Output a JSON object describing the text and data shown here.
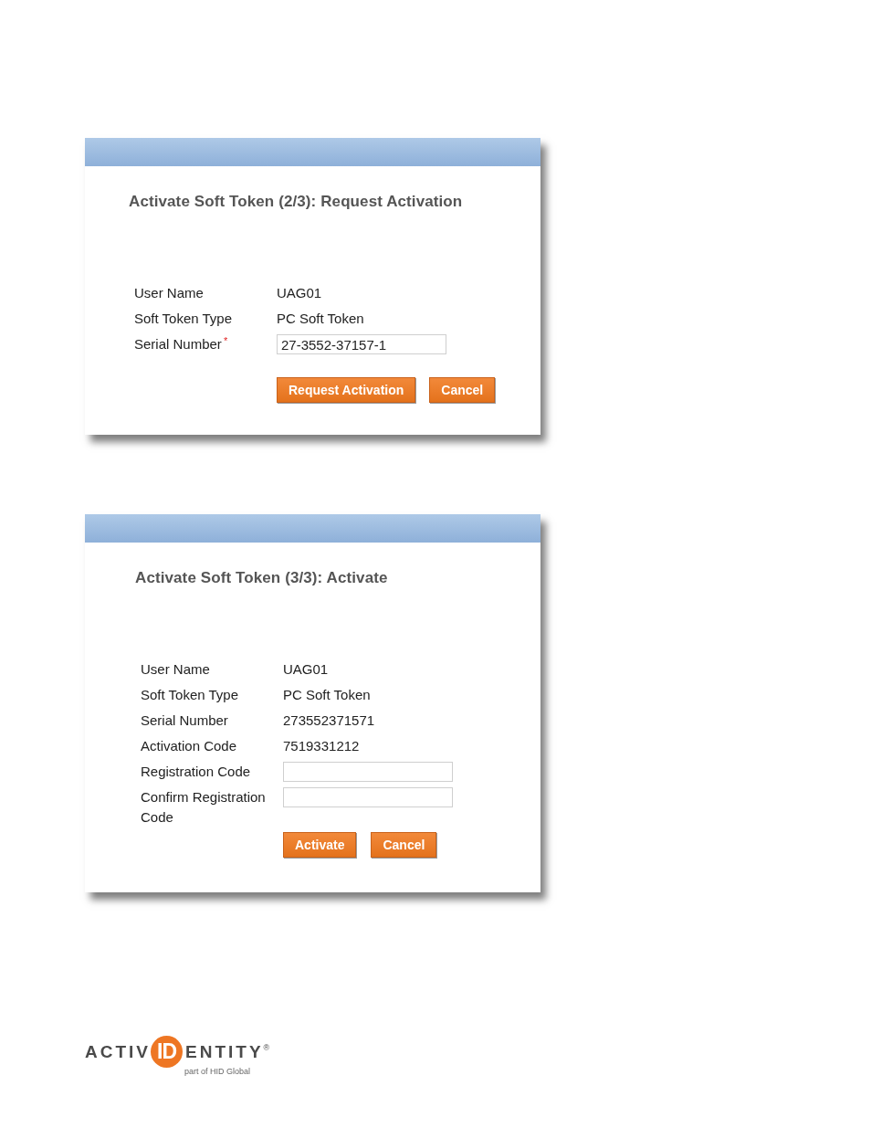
{
  "panels": [
    {
      "title": "Activate Soft Token (2/3): Request Activation",
      "rows": [
        {
          "kind": "text",
          "label": "User Name",
          "value": "UAG01"
        },
        {
          "kind": "text",
          "label": "Soft Token Type",
          "value": "PC Soft Token"
        },
        {
          "kind": "input",
          "label": "Serial Number",
          "required_mark": "*",
          "value": "27-3552-37157-1"
        }
      ],
      "buttons": [
        "Request Activation",
        "Cancel"
      ]
    },
    {
      "title": "Activate Soft Token (3/3): Activate",
      "rows": [
        {
          "kind": "text",
          "label": "User Name",
          "value": "UAG01"
        },
        {
          "kind": "text",
          "label": "Soft Token Type",
          "value": "PC Soft Token"
        },
        {
          "kind": "text",
          "label": "Serial Number",
          "value": "273552371571"
        },
        {
          "kind": "text",
          "label": "Activation Code",
          "value": "7519331212"
        },
        {
          "kind": "input",
          "label": "Registration Code"
        },
        {
          "kind": "input",
          "label": "Confirm Registration Code"
        }
      ],
      "buttons": [
        "Activate",
        "Cancel"
      ]
    }
  ],
  "logo": {
    "prefix": "ACTIV",
    "badge": "ID",
    "suffix": "ENTITY",
    "mark": "®",
    "tagline": "part of HID Global"
  }
}
